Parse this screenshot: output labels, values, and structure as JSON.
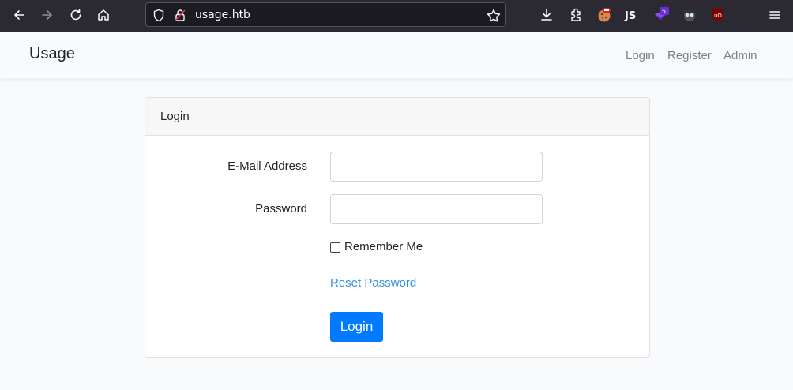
{
  "browser": {
    "url": "usage.htb",
    "extension_badge": "5",
    "icons": [
      "back-icon",
      "forward-icon",
      "reload-icon",
      "home-icon",
      "shield-icon",
      "lock-icon",
      "bookmark-star-icon",
      "download-icon",
      "extensions-icon",
      "cookie-extension-icon",
      "js-extension-icon",
      "hackbar-extension-icon",
      "spy-extension-icon",
      "ublock-extension-icon",
      "menu-icon"
    ]
  },
  "navbar": {
    "brand": "Usage",
    "links": [
      "Login",
      "Register",
      "Admin"
    ]
  },
  "card": {
    "header": "Login",
    "email_label": "E-Mail Address",
    "email_value": "",
    "password_label": "Password",
    "password_value": "",
    "remember_label": "Remember Me",
    "reset_link": "Reset Password",
    "submit_label": "Login"
  },
  "colors": {
    "primary": "#007bff",
    "link": "#3490dc",
    "chrome": "#2b2a33"
  }
}
